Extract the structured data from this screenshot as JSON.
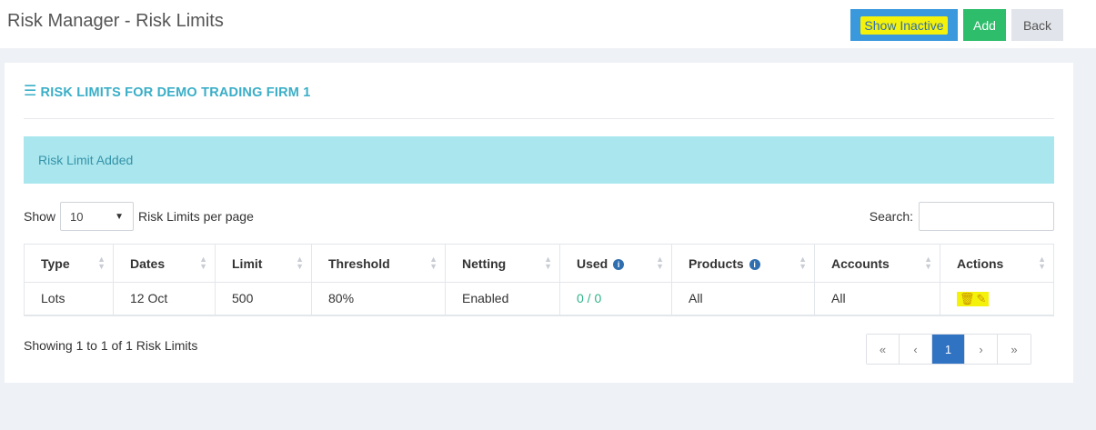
{
  "header": {
    "title": "Risk Manager - Risk Limits",
    "show_inactive_label": "Show Inactive",
    "add_label": "Add",
    "back_label": "Back"
  },
  "panel": {
    "heading": "RISK LIMITS FOR DEMO TRADING FIRM 1",
    "alert": "Risk Limit Added"
  },
  "controls": {
    "show_label": "Show",
    "page_size": "10",
    "per_page_label": "Risk Limits per page",
    "search_label": "Search:",
    "search_value": ""
  },
  "table": {
    "columns": [
      "Type",
      "Dates",
      "Limit",
      "Threshold",
      "Netting",
      "Used",
      "Products",
      "Accounts",
      "Actions"
    ],
    "rows": [
      {
        "type": "Lots",
        "dates": "12 Oct",
        "limit": "500",
        "threshold": "80%",
        "netting": "Enabled",
        "used_value": "0",
        "used_sep": " / ",
        "used_total": "0",
        "products": "All",
        "accounts": "All"
      }
    ]
  },
  "footer": {
    "info": "Showing 1 to 1 of 1 Risk Limits",
    "pages": [
      "«",
      "‹",
      "1",
      "›",
      "»"
    ],
    "current_page": "1"
  },
  "icons": {
    "menu": "menu-icon",
    "info": "info-circle-icon",
    "delete": "trash-icon",
    "edit": "edit-icon"
  },
  "colors": {
    "accent": "#3aaec7",
    "primary": "#2f73c2",
    "success": "#2ebd6b",
    "highlight": "#f4f20a"
  }
}
